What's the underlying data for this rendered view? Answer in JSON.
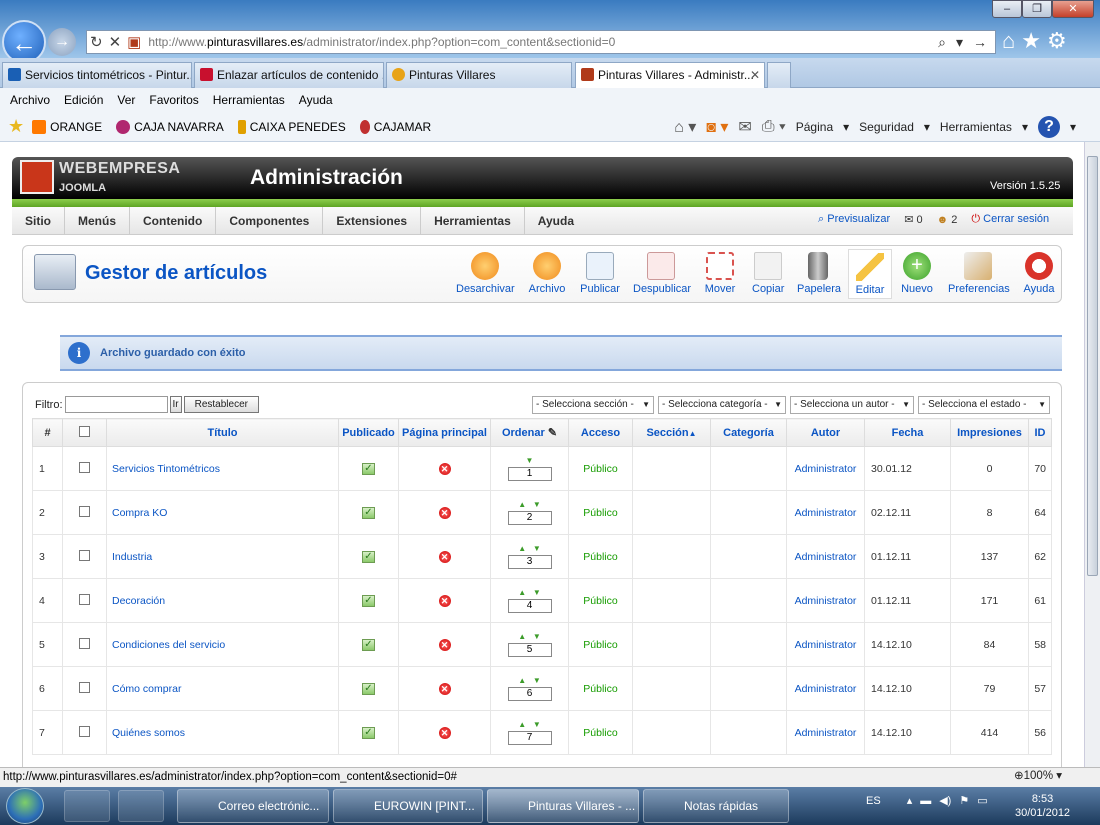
{
  "browser": {
    "url_prefix": "http://www.",
    "url_domain": "pinturasvillares.es",
    "url_path": "/administrator/index.php?option=com_content&sectionid=0",
    "tabs": [
      {
        "label": "Servicios tintométricos - Pintur...",
        "color": "#1a5fb4"
      },
      {
        "label": "Enlazar artículos de contenido ...",
        "color": "#c8102e"
      },
      {
        "label": "Pinturas Villares",
        "color": "#e8a317"
      },
      {
        "label": "Pinturas Villares - Administr...",
        "color": "#b03a1a"
      }
    ],
    "menu": [
      "Archivo",
      "Edición",
      "Ver",
      "Favoritos",
      "Herramientas",
      "Ayuda"
    ],
    "favorites": [
      {
        "label": "ORANGE",
        "color": "#ff7900"
      },
      {
        "label": "CAJA NAVARRA",
        "color": "#b0276f"
      },
      {
        "label": "CAIXA PENEDES",
        "color": "#e0a000"
      },
      {
        "label": "CAJAMAR",
        "color": "#c03030"
      }
    ],
    "commands": [
      "Página",
      "Seguridad",
      "Herramientas"
    ],
    "status_url": "http://www.pinturasvillares.es/administrator/index.php?option=com_content&sectionid=0#",
    "zoom": "100%"
  },
  "joomla": {
    "brand": "WEBEMPRESA",
    "brand_sub": "JOOMLA",
    "title": "Administración",
    "version": "Versión 1.5.25",
    "menu": [
      "Sitio",
      "Menús",
      "Contenido",
      "Componentes",
      "Extensiones",
      "Herramientas",
      "Ayuda"
    ],
    "preview": "Previsualizar",
    "messages_count": "0",
    "users_count": "2",
    "logout": "Cerrar sesión",
    "page_title": "Gestor de artículos",
    "toolbar": [
      {
        "label": "Desarchivar",
        "color": "#f08a1c"
      },
      {
        "label": "Archivo",
        "color": "#f08a1c"
      },
      {
        "label": "Publicar",
        "color": "#cfe3f5"
      },
      {
        "label": "Despublicar",
        "color": "#f0c0c0"
      },
      {
        "label": "Mover",
        "color": "#d9534f"
      },
      {
        "label": "Copiar",
        "color": "#e6e6e6"
      },
      {
        "label": "Papelera",
        "color": "#8a8f96"
      },
      {
        "label": "Editar",
        "color": "#f5c342"
      },
      {
        "label": "Nuevo",
        "color": "#4fb83a"
      },
      {
        "label": "Preferencias",
        "color": "#d8b070"
      },
      {
        "label": "Ayuda",
        "color": "#d9332a"
      }
    ],
    "message": "Archivo guardado con éxito",
    "filter_label": "Filtro:",
    "go_label": "Ir",
    "reset_label": "Restablecer",
    "selects": [
      "- Selecciona sección -",
      "- Selecciona categoría -",
      "- Selecciona un autor -",
      "- Selecciona el estado -"
    ],
    "columns": [
      "#",
      "",
      "Título",
      "Publicado",
      "Página principal",
      "Ordenar",
      "Acceso",
      "Sección",
      "Categoría",
      "Autor",
      "Fecha",
      "Impresiones",
      "ID"
    ],
    "rows": [
      {
        "n": "1",
        "title": "Servicios Tintométricos",
        "order": "1",
        "access": "Público",
        "author": "Administrator",
        "date": "30.01.12",
        "hits": "0",
        "id": "70",
        "up": false
      },
      {
        "n": "2",
        "title": "Compra KO",
        "order": "2",
        "access": "Público",
        "author": "Administrator",
        "date": "02.12.11",
        "hits": "8",
        "id": "64",
        "up": true
      },
      {
        "n": "3",
        "title": "Industria",
        "order": "3",
        "access": "Público",
        "author": "Administrator",
        "date": "01.12.11",
        "hits": "137",
        "id": "62",
        "up": true
      },
      {
        "n": "4",
        "title": "Decoración",
        "order": "4",
        "access": "Público",
        "author": "Administrator",
        "date": "01.12.11",
        "hits": "171",
        "id": "61",
        "up": true
      },
      {
        "n": "5",
        "title": "Condiciones del servicio",
        "order": "5",
        "access": "Público",
        "author": "Administrator",
        "date": "14.12.10",
        "hits": "84",
        "id": "58",
        "up": true
      },
      {
        "n": "6",
        "title": "Cómo comprar",
        "order": "6",
        "access": "Público",
        "author": "Administrator",
        "date": "14.12.10",
        "hits": "79",
        "id": "57",
        "up": true
      },
      {
        "n": "7",
        "title": "Quiénes somos",
        "order": "7",
        "access": "Público",
        "author": "Administrator",
        "date": "14.12.10",
        "hits": "414",
        "id": "56",
        "up": true
      }
    ]
  },
  "taskbar": {
    "tasks": [
      "Correo electrónic...",
      "EUROWIN [PINT...",
      "Pinturas Villares - ...",
      "Notas rápidas"
    ],
    "lang": "ES",
    "time": "8:53",
    "date": "30/01/2012"
  }
}
